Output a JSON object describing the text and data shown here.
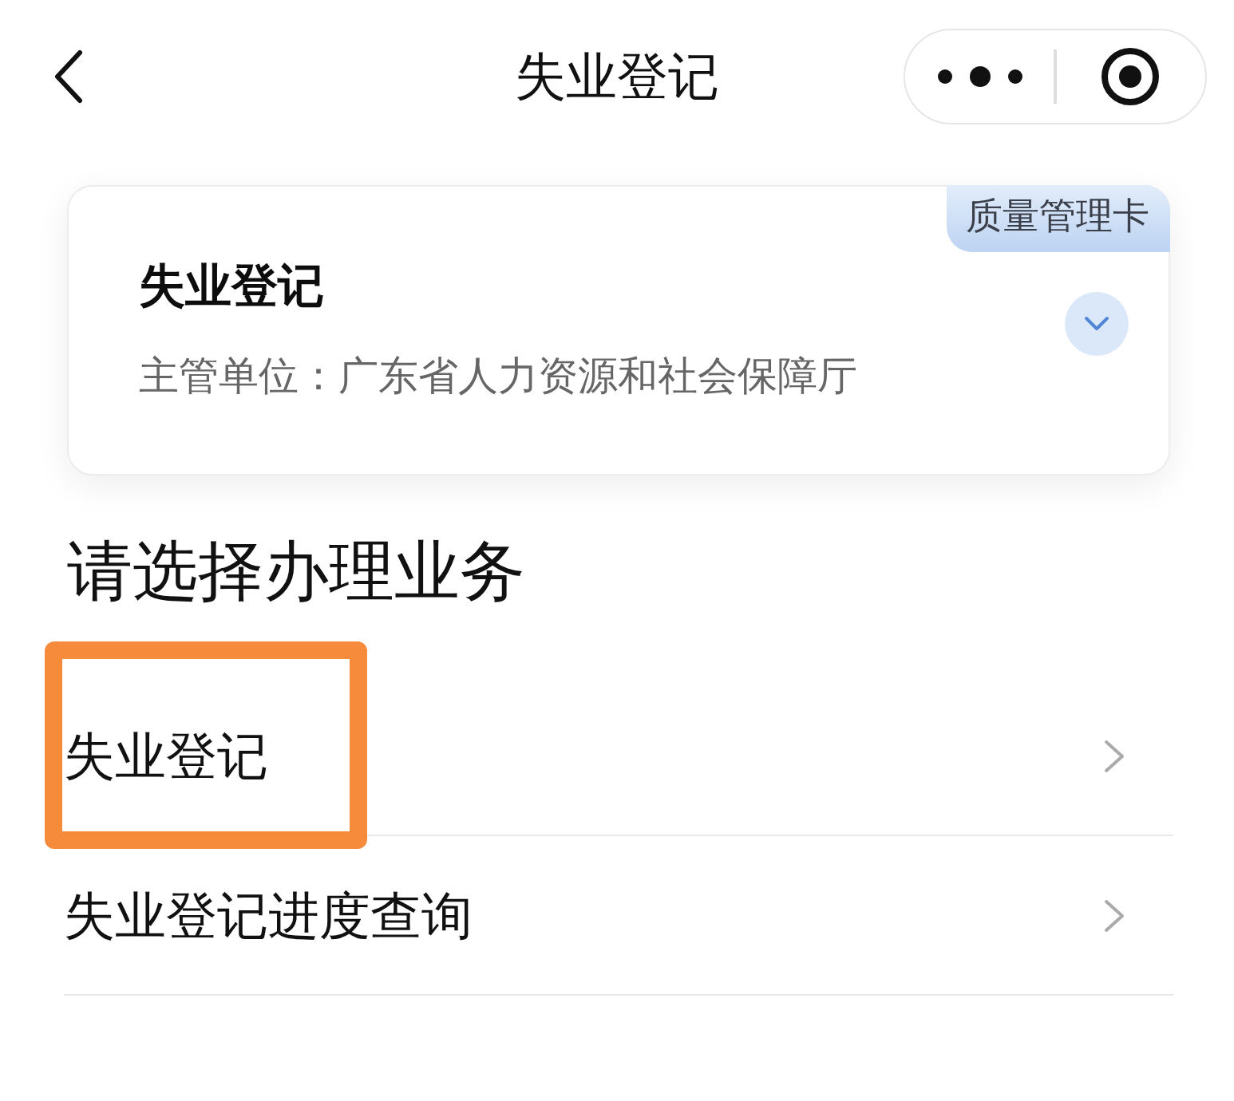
{
  "nav_bar": {
    "title": "失业登记"
  },
  "info_card": {
    "badge": "质量管理卡",
    "title": "失业登记",
    "department": "主管单位：广东省人力资源和社会保障厅",
    "expanded": false
  },
  "section": {
    "heading": "请选择办理业务",
    "items": [
      {
        "label": "失业登记",
        "highlighted": true
      },
      {
        "label": "失业登记进度查询",
        "highlighted": false
      }
    ]
  }
}
